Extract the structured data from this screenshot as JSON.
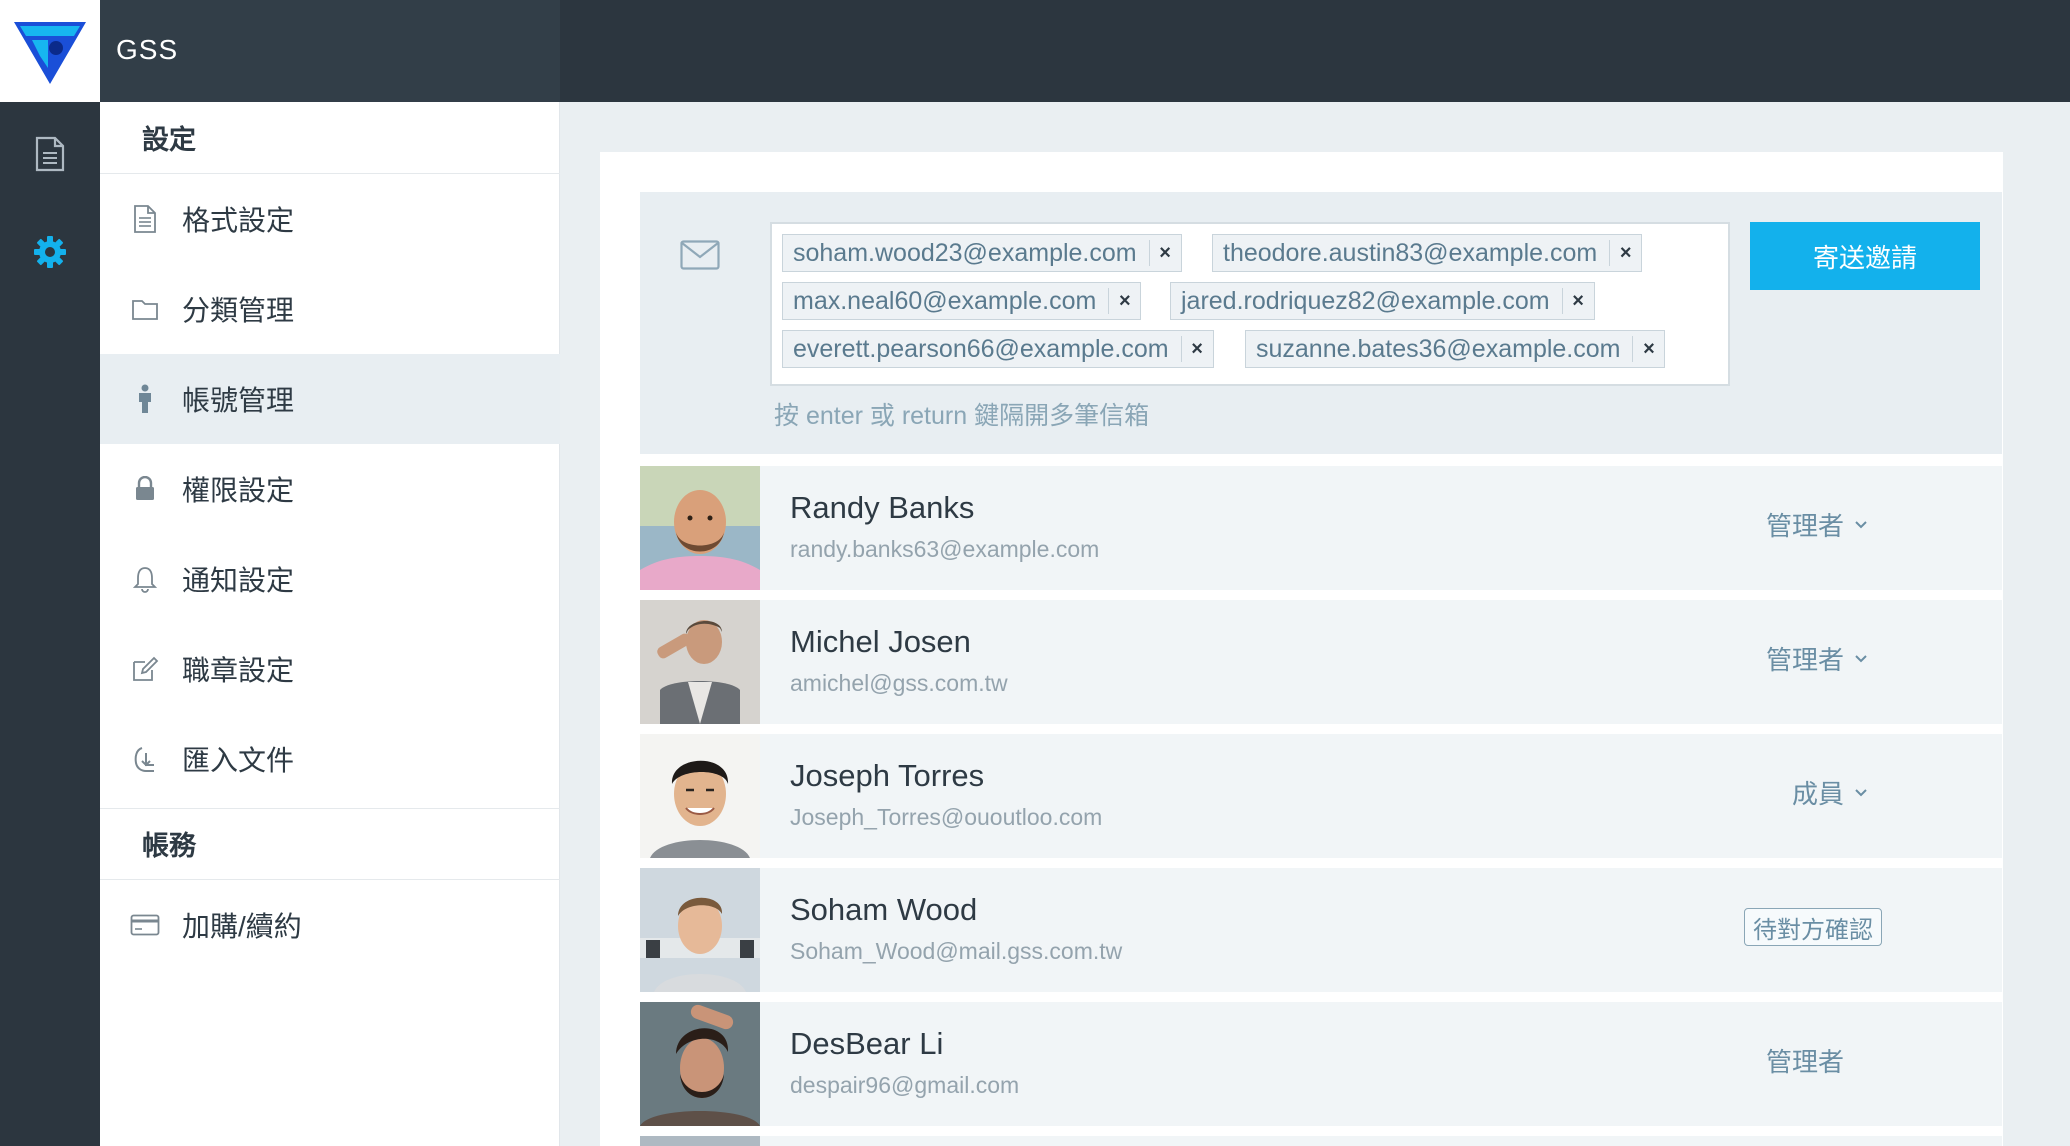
{
  "app": {
    "name": "GSS"
  },
  "sidebar": {
    "settings_title": "設定",
    "settings_items": [
      {
        "label": "格式設定",
        "icon": "document-icon"
      },
      {
        "label": "分類管理",
        "icon": "folder-icon"
      },
      {
        "label": "帳號管理",
        "icon": "person-icon",
        "active": true
      },
      {
        "label": "權限設定",
        "icon": "lock-icon"
      },
      {
        "label": "通知設定",
        "icon": "bell-icon"
      },
      {
        "label": "職章設定",
        "icon": "edit-icon"
      },
      {
        "label": "匯入文件",
        "icon": "import-icon"
      }
    ],
    "account_title": "帳務",
    "account_items": [
      {
        "label": "加購/續約",
        "icon": "credit-card-icon"
      }
    ]
  },
  "invite": {
    "emails": [
      "soham.wood23@example.com",
      "theodore.austin83@example.com",
      "max.neal60@example.com",
      "jared.rodriquez82@example.com",
      "everett.pearson66@example.com",
      "suzanne.bates36@example.com"
    ],
    "remove_symbol": "×",
    "hint": "按 enter 或 return 鍵隔開多筆信箱",
    "send_label": "寄送邀請"
  },
  "members": [
    {
      "name": "Randy Banks",
      "email": "randy.banks63@example.com",
      "role": "管理者",
      "dropdown": true
    },
    {
      "name": "Michel Josen",
      "email": "amichel@gss.com.tw",
      "role": "管理者",
      "dropdown": true
    },
    {
      "name": "Joseph Torres",
      "email": "Joseph_Torres@ououtloo.com",
      "role": "成員",
      "dropdown": true
    },
    {
      "name": "Soham Wood",
      "email": "Soham_Wood@mail.gss.com.tw",
      "status": "待對方確認"
    },
    {
      "name": "DesBear Li",
      "email": "despair96@gmail.com",
      "role": "管理者",
      "dropdown": false
    }
  ],
  "colors": {
    "topbar": "#2c363f",
    "accent": "#13b1ec",
    "active_item": "#e8eef2",
    "role_text": "#6a8ea4"
  }
}
